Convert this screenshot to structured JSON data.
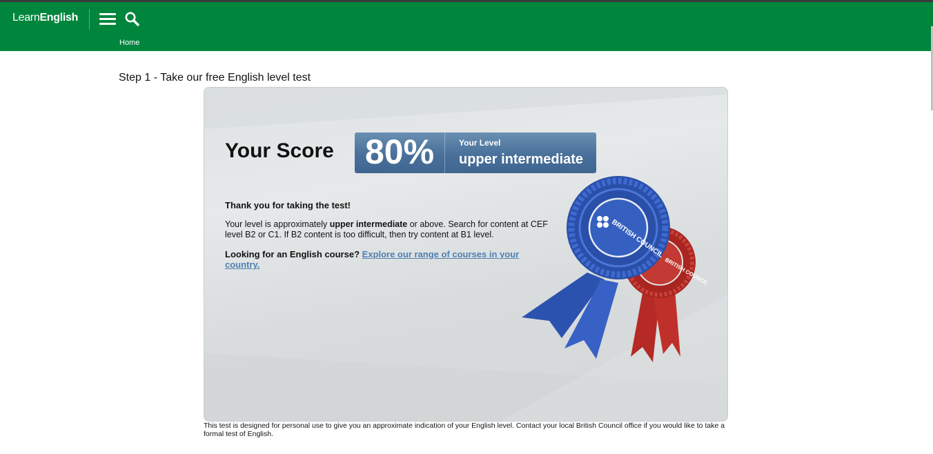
{
  "header": {
    "brand_light": "Learn",
    "brand_bold": "English",
    "breadcrumb_home": "Home",
    "color": "#00853d"
  },
  "main": {
    "step_title": "Step 1 - Take our free English level test",
    "score_label": "Your Score",
    "score_percent": "80%",
    "level_caption": "Your Level",
    "level_value": "upper intermediate",
    "thanks": "Thank you for taking the test!",
    "level_text_prefix": "Your level is approximately",
    "level_text_bold": "upper intermediate",
    "level_text_suffix": "or above. Search for content at CEF level B2 or C1. If B2 content is too difficult, then try content at B1 level.",
    "course_prefix": "Looking for an English course?",
    "course_link": "Explore our range of courses in your country.",
    "rosette_text_blue": "BRITISH COUNCIL",
    "rosette_text_red": "BRITISH COUNCIL",
    "disclaimer": "This test is designed for personal use to give you an approximate indication of your English level. Contact your local British Council office if you would like to take a formal test of English."
  },
  "icons": {
    "menu": "hamburger-menu-icon",
    "search": "search-icon",
    "rosette": "rosette-award-icon"
  },
  "colors": {
    "score_box": "#48709a",
    "link": "#4f7fb0",
    "rosette_blue": "#2f57b8",
    "rosette_red": "#c0302a"
  }
}
